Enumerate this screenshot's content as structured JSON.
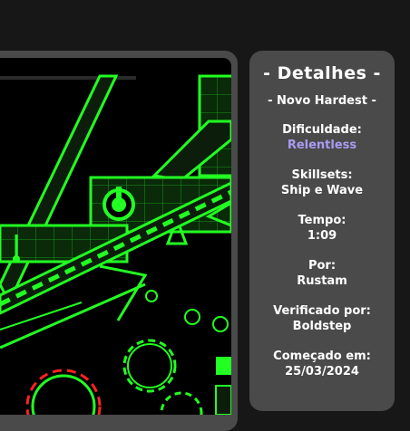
{
  "details": {
    "title": "- Detalhes -",
    "subtitle": "- Novo Hardest -",
    "fields": [
      {
        "label": "Dificuldade:",
        "value": "Relentless",
        "accent": true
      },
      {
        "label": "Skillsets:",
        "value": "Ship e Wave"
      },
      {
        "label": "Tempo:",
        "value": "1:09"
      },
      {
        "label": "Por:",
        "value": "Rustam"
      },
      {
        "label": "Verificado por:",
        "value": "Boldstep"
      },
      {
        "label": "Começado em:",
        "value": "25/03/2024"
      }
    ]
  },
  "colors": {
    "background": "#171717",
    "panel": "#4a4a4a",
    "accent": "#a99bf2",
    "level_green": "#22ff22"
  },
  "thumbnail": {
    "alt": "level-thumbnail",
    "icons": [
      "cog-icon",
      "orb-icon",
      "spike-icon"
    ]
  }
}
